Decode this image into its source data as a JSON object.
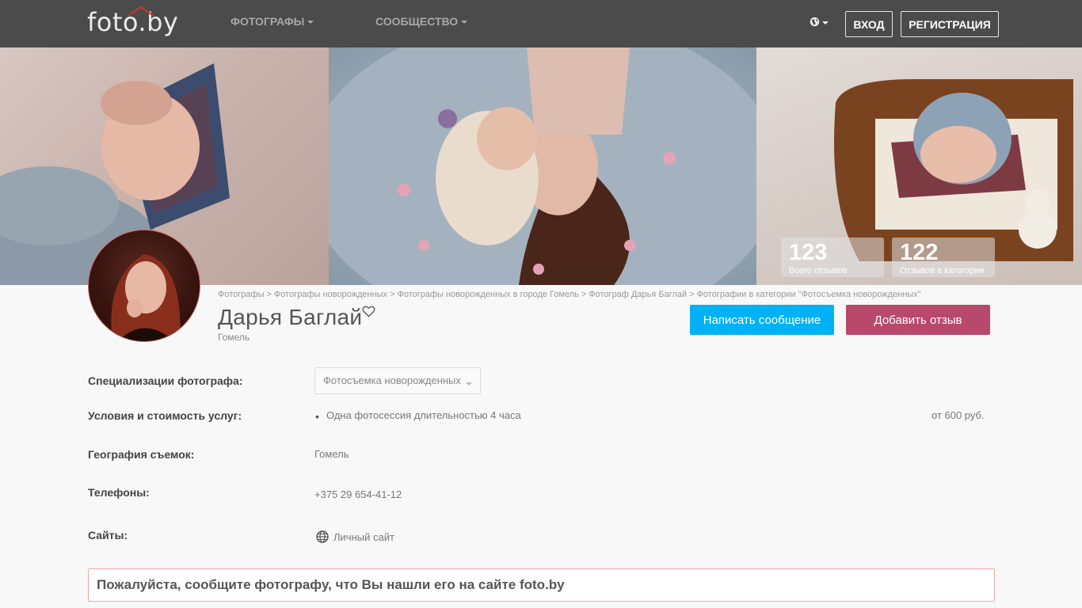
{
  "nav": {
    "logo": "foto.by",
    "photographers": "Фотографы",
    "community": "Сообщество",
    "login": "Вход",
    "register": "Регистрация"
  },
  "stats": [
    {
      "value": "123",
      "label": "Всего отзывов"
    },
    {
      "value": "122",
      "label": "Отзывов в категории"
    }
  ],
  "breadcrumbs": [
    "Фотографы",
    "Фотографы новорожденных",
    "Фотографы новорожденных в городе Гомель",
    "Фотограф Дарья Баглай",
    "Фотографии в категории \"Фотосъемка новорожденных\""
  ],
  "profile": {
    "name": "Дарья Баглай",
    "city": "Гомель",
    "message_button": "Написать сообщение",
    "review_button": "Добавить отзыв"
  },
  "info": {
    "specialization_label": "Специализации фотографа:",
    "specialization_value": "Фотосъемка новорожденных",
    "services_label": "Условия и стоимость услуг:",
    "service_item": "Одна фотосессия длительностью 4 часа",
    "service_price": "от 600 руб.",
    "geo_label": "География съемок:",
    "geo_value": "Гомель",
    "phones_label": "Телефоны:",
    "phone_value": "+375 29 654-41-12",
    "sites_label": "Сайты:",
    "site_value": "Личный сайт"
  },
  "notice": "Пожалуйста, сообщите фотографу, что Вы нашли его на сайте foto.by",
  "colors": {
    "topbar": "#4b4b4b",
    "message_button": "#00b1f5",
    "review_button": "#b8496b",
    "notice_border": "#e7a9a9"
  }
}
